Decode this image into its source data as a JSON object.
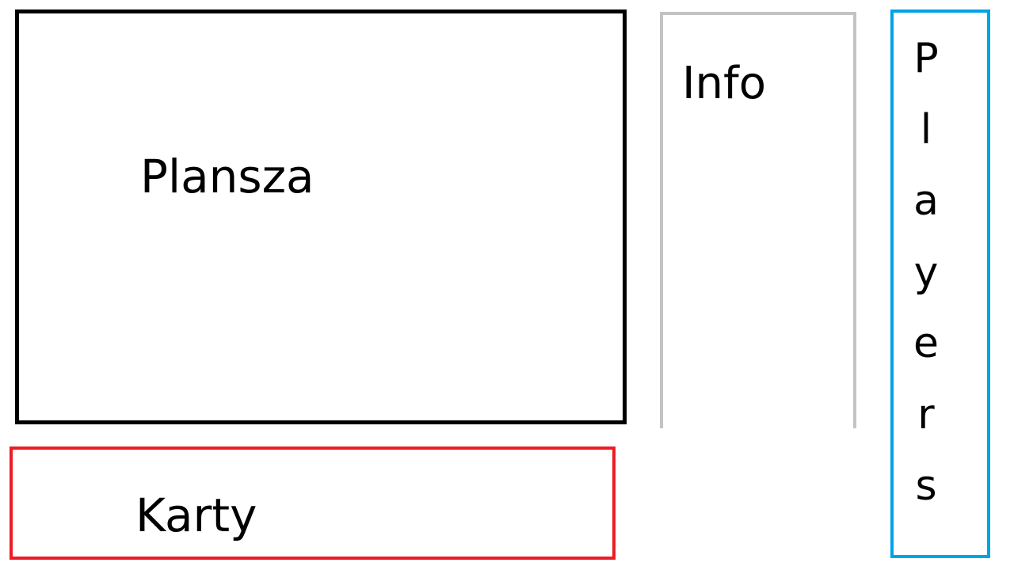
{
  "panels": {
    "plansza": {
      "label": "Plansza",
      "border_color": "#000000"
    },
    "info": {
      "label": "Info",
      "border_color": "#c3c3c3"
    },
    "players": {
      "label": "Players",
      "letters": [
        "P",
        "l",
        "a",
        "y",
        "e",
        "r",
        "s"
      ],
      "border_color": "#00a2e8"
    },
    "karty": {
      "label": "Karty",
      "border_color": "#ed1c24"
    }
  }
}
